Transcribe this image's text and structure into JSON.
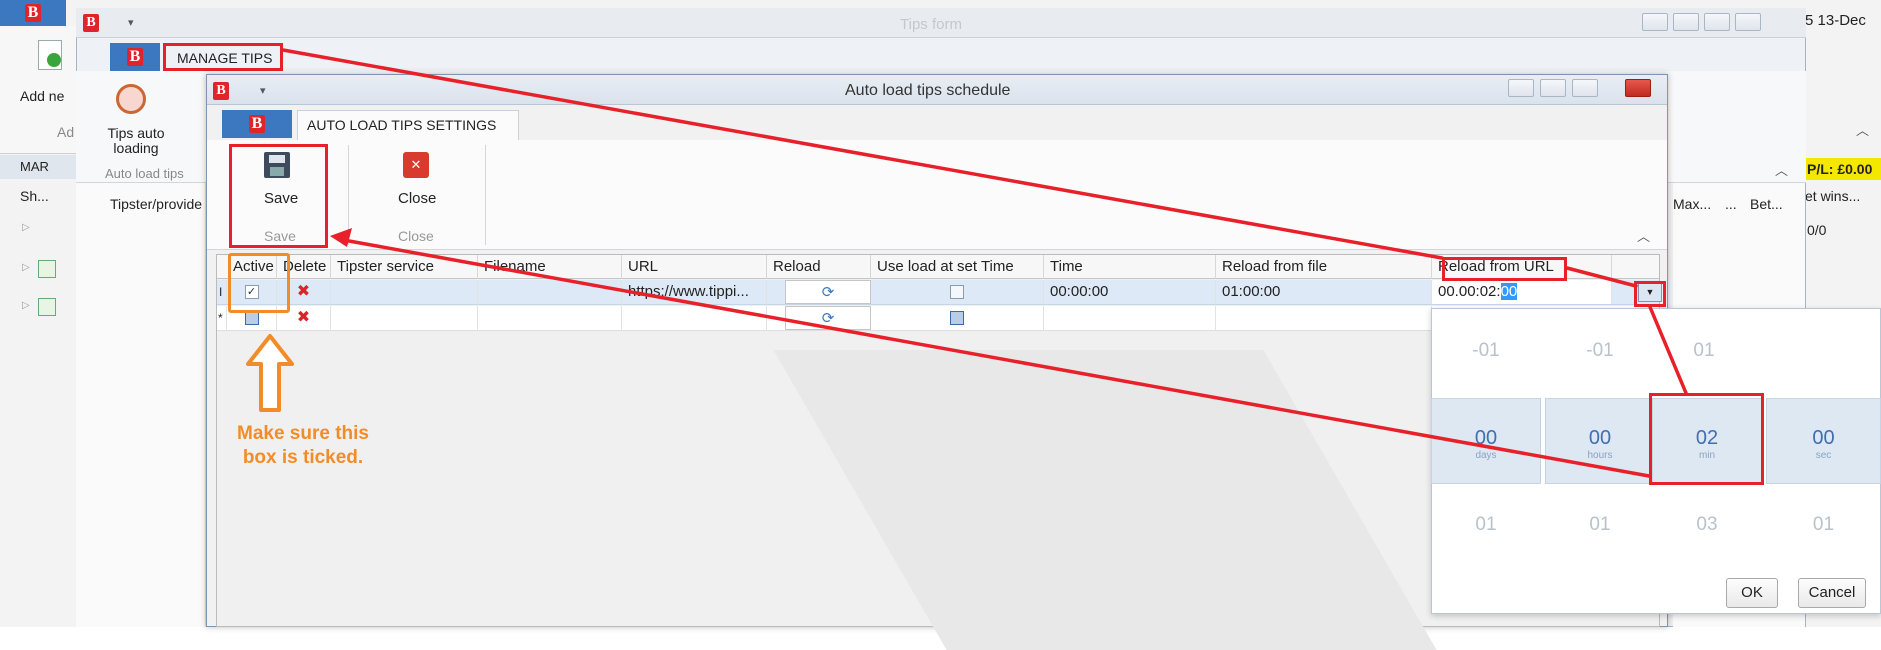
{
  "background_app": {
    "date_fragment": "5 13-Dec",
    "add_label": "Add ne",
    "ad_label": "Ad",
    "mar_label": "MAR",
    "sh_label": "Sh...",
    "pl_label": "P/L: £0.00",
    "col_max": "Max...",
    "col_dots": "...",
    "col_bet": "Bet...",
    "col_bet_wins": "et wins...",
    "cell_zero": "0/0",
    "tipster_provider": "Tipster/provide"
  },
  "tips_form": {
    "title": "Tips form",
    "tab_label": "MANAGE TIPS",
    "ribbon_button": "Tips auto loading",
    "ribbon_group": "Auto load tips"
  },
  "dialog": {
    "title": "Auto load tips schedule",
    "tab_label": "AUTO LOAD TIPS SETTINGS",
    "save_label": "Save",
    "save_group": "Save",
    "close_label": "Close",
    "close_group": "Close",
    "columns": [
      "Active",
      "Delete",
      "Tipster service",
      "Filename",
      "URL",
      "Reload",
      "Use load at set Time",
      "Time",
      "Reload from file",
      "Reload from URL"
    ],
    "row1": {
      "marker": "I",
      "url": "https://www.tippi...",
      "time": "00:00:00",
      "reload_from_file": "01:00:00",
      "reload_from_url_prefix": "00.00:02:",
      "reload_from_url_selected": "00"
    },
    "row2_marker": "*"
  },
  "time_picker": {
    "above": [
      "-01",
      "-01",
      "01",
      ""
    ],
    "values": [
      "00",
      "00",
      "02",
      "00"
    ],
    "units": [
      "days",
      "hours",
      "min",
      "sec"
    ],
    "below": [
      "01",
      "01",
      "03",
      "01"
    ],
    "ok_label": "OK",
    "cancel_label": "Cancel"
  },
  "annotation": {
    "note": "Make sure this box is ticked."
  },
  "colors": {
    "accent_blue": "#3b78c0",
    "annotation_red": "#e8202a",
    "annotation_orange": "#f28c28"
  }
}
